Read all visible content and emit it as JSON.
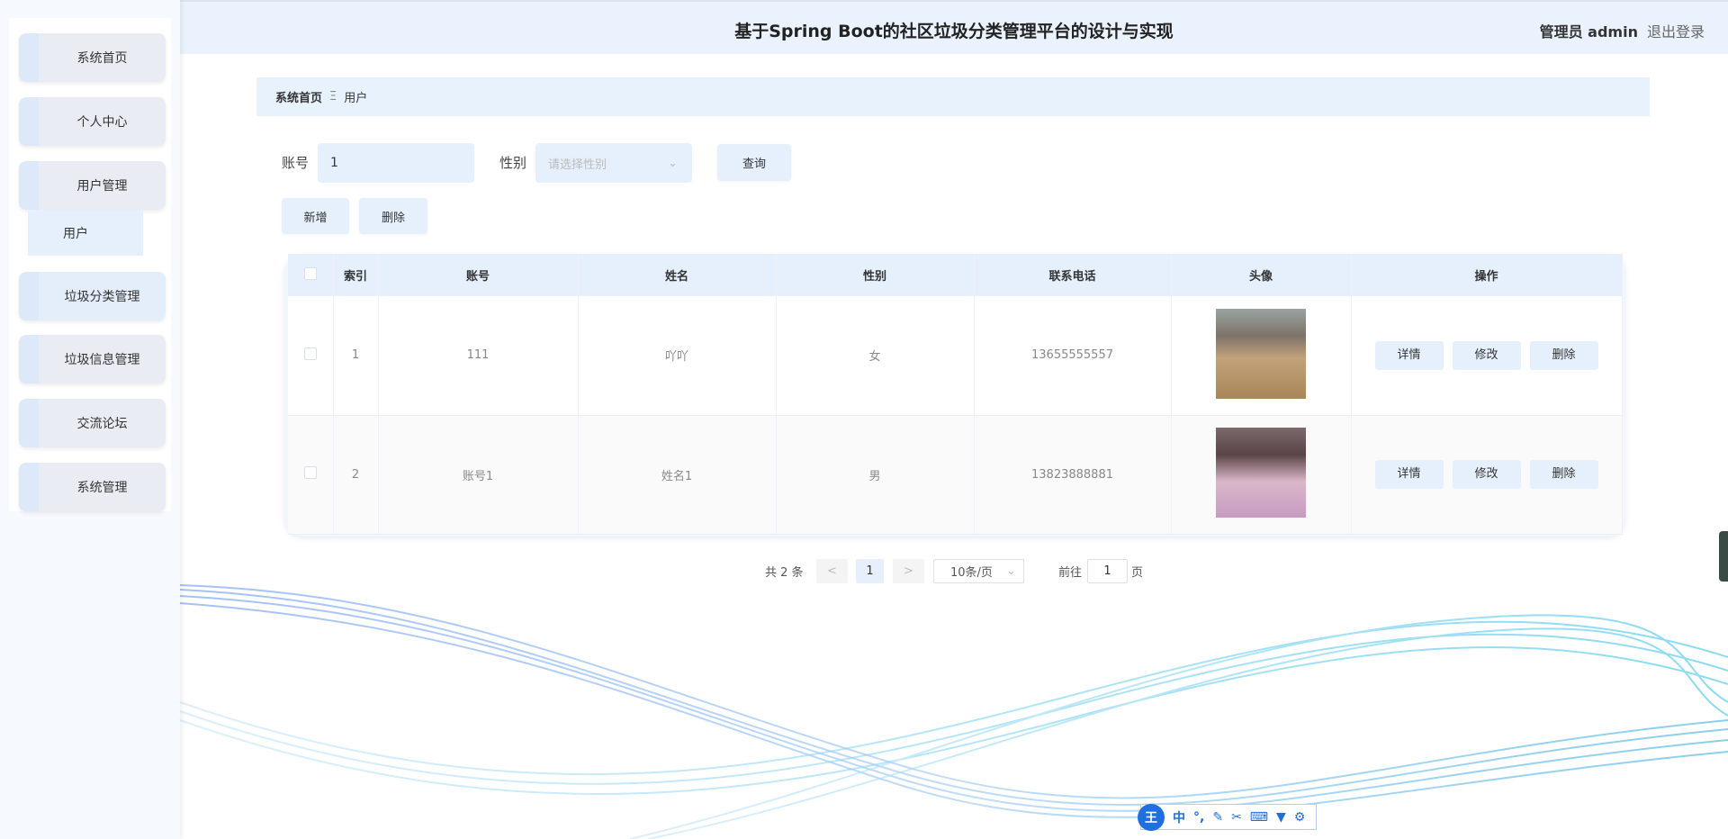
{
  "header": {
    "title": "基于Spring Boot的社区垃圾分类管理平台的设计与实现",
    "user": "管理员 admin",
    "logout": "退出登录"
  },
  "sidebar": {
    "items": [
      {
        "label": "系统首页"
      },
      {
        "label": "个人中心"
      },
      {
        "label": "用户管理"
      },
      {
        "label": "垃圾分类管理"
      },
      {
        "label": "垃圾信息管理"
      },
      {
        "label": "交流论坛"
      },
      {
        "label": "系统管理"
      }
    ],
    "sub_item": "用户"
  },
  "breadcrumb": {
    "home": "系统首页",
    "sep": "Ξ",
    "current": "用户"
  },
  "search": {
    "account_label": "账号",
    "account_value": "1",
    "gender_label": "性别",
    "gender_placeholder": "请选择性别",
    "query": "查询"
  },
  "actions": {
    "add": "新增",
    "delete": "删除"
  },
  "table": {
    "columns": [
      "索引",
      "账号",
      "姓名",
      "性别",
      "联系电话",
      "头像",
      "操作"
    ],
    "rows": [
      {
        "index": "1",
        "account": "111",
        "name": "吖吖",
        "gender": "女",
        "phone": "13655555557"
      },
      {
        "index": "2",
        "account": "账号1",
        "name": "姓名1",
        "gender": "男",
        "phone": "13823888881"
      }
    ],
    "row_actions": {
      "detail": "详情",
      "edit": "修改",
      "delete": "删除"
    }
  },
  "pagination": {
    "total": "共 2 条",
    "prev": "<",
    "page": "1",
    "next": ">",
    "page_size": "10条/页",
    "goto": "前往",
    "goto_value": "1",
    "page_unit": "页"
  },
  "ime": {
    "logo": "王",
    "lang": "中",
    "punct": "°,"
  },
  "colors": {
    "accent": "#e6f0fc",
    "header": "#eaf3fd",
    "ime": "#1e6fe0"
  }
}
